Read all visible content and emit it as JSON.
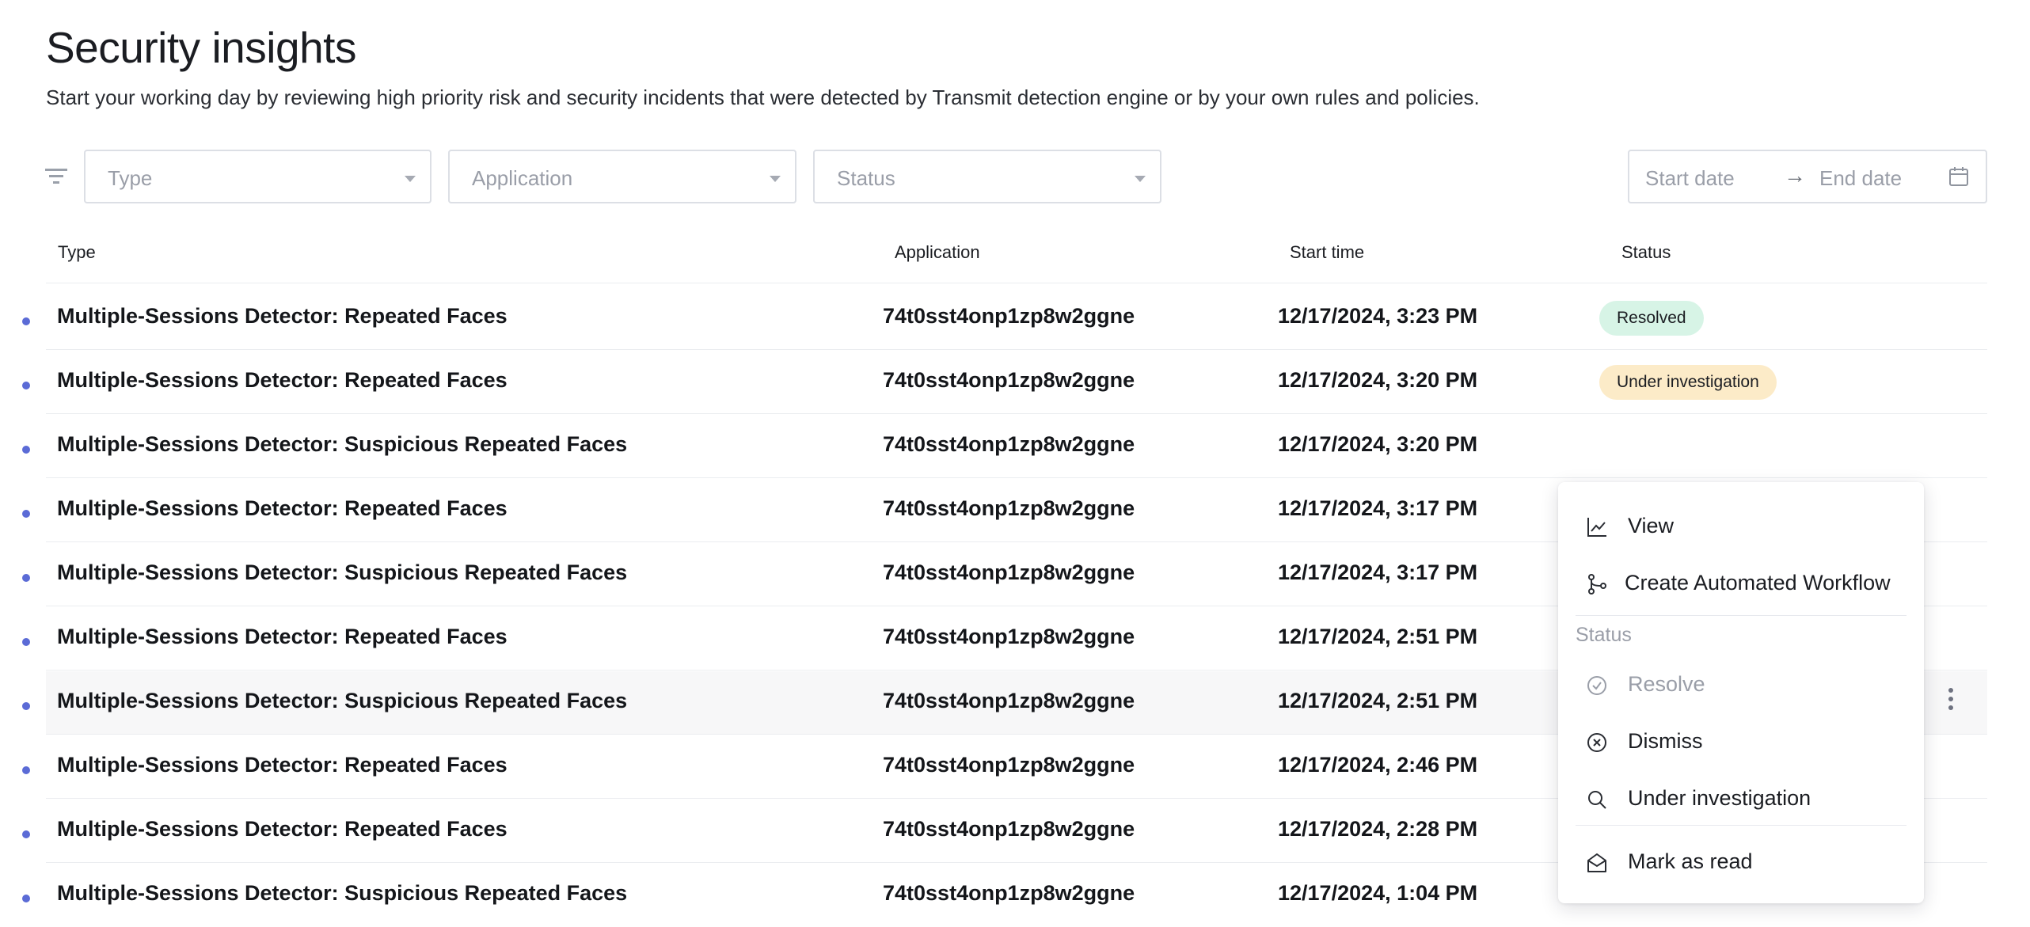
{
  "header": {
    "title": "Security insights",
    "subtitle": "Start your working day by reviewing high priority risk and security incidents that were detected by Transmit detection engine or by your own rules and policies."
  },
  "filters": {
    "type_placeholder": "Type",
    "application_placeholder": "Application",
    "status_placeholder": "Status",
    "start_date_placeholder": "Start date",
    "end_date_placeholder": "End date",
    "date_separator": "→"
  },
  "table": {
    "columns": [
      "Type",
      "Application",
      "Start time",
      "Status"
    ],
    "rows": [
      {
        "type": "Multiple-Sessions Detector: Repeated Faces",
        "application": "74t0sst4onp1zp8w2ggne",
        "start_time": "12/17/2024, 3:23 PM",
        "status": "Resolved"
      },
      {
        "type": "Multiple-Sessions Detector: Repeated Faces",
        "application": "74t0sst4onp1zp8w2ggne",
        "start_time": "12/17/2024, 3:20 PM",
        "status": "Under investigation"
      },
      {
        "type": "Multiple-Sessions Detector: Suspicious Repeated Faces",
        "application": "74t0sst4onp1zp8w2ggne",
        "start_time": "12/17/2024, 3:20 PM",
        "status": ""
      },
      {
        "type": "Multiple-Sessions Detector: Repeated Faces",
        "application": "74t0sst4onp1zp8w2ggne",
        "start_time": "12/17/2024, 3:17 PM",
        "status": ""
      },
      {
        "type": "Multiple-Sessions Detector: Suspicious Repeated Faces",
        "application": "74t0sst4onp1zp8w2ggne",
        "start_time": "12/17/2024, 3:17 PM",
        "status": ""
      },
      {
        "type": "Multiple-Sessions Detector: Repeated Faces",
        "application": "74t0sst4onp1zp8w2ggne",
        "start_time": "12/17/2024, 2:51 PM",
        "status": ""
      },
      {
        "type": "Multiple-Sessions Detector: Suspicious Repeated Faces",
        "application": "74t0sst4onp1zp8w2ggne",
        "start_time": "12/17/2024, 2:51 PM",
        "status": ""
      },
      {
        "type": "Multiple-Sessions Detector: Repeated Faces",
        "application": "74t0sst4onp1zp8w2ggne",
        "start_time": "12/17/2024, 2:46 PM",
        "status": ""
      },
      {
        "type": "Multiple-Sessions Detector: Repeated Faces",
        "application": "74t0sst4onp1zp8w2ggne",
        "start_time": "12/17/2024, 2:28 PM",
        "status": ""
      },
      {
        "type": "Multiple-Sessions Detector: Suspicious Repeated Faces",
        "application": "74t0sst4onp1zp8w2ggne",
        "start_time": "12/17/2024, 1:04 PM",
        "status": ""
      }
    ]
  },
  "context_menu": {
    "view": "View",
    "create_workflow": "Create Automated Workflow",
    "status_section": "Status",
    "resolve": "Resolve",
    "dismiss": "Dismiss",
    "under_investigation": "Under investigation",
    "mark_as_read": "Mark as read"
  },
  "colors": {
    "unread_dot": "#5b6bd6",
    "resolved_badge": "#d7f4e6",
    "investigation_badge": "#fcebc8"
  }
}
